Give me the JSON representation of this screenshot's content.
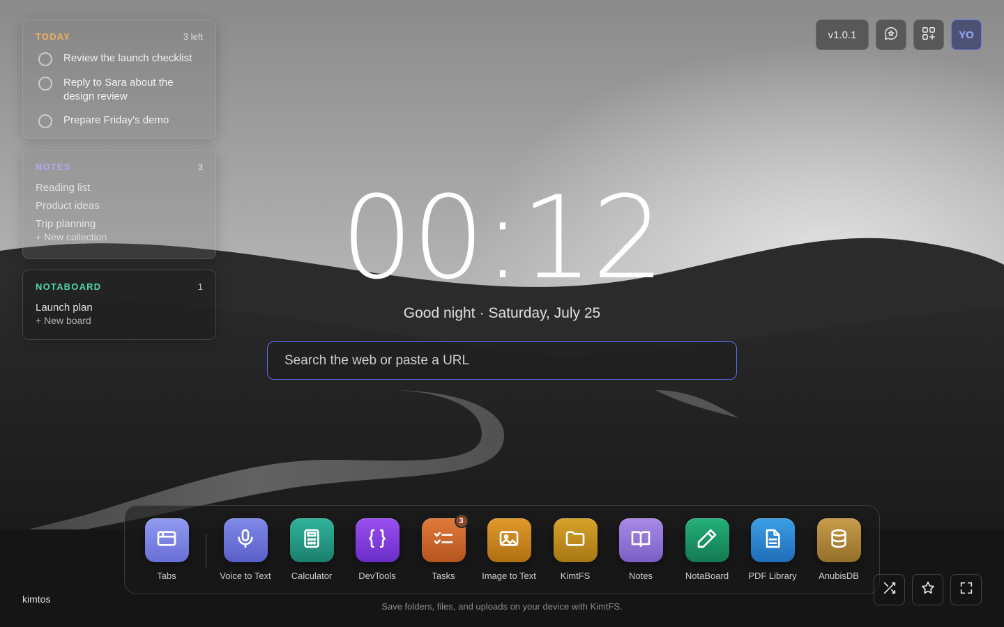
{
  "today": {
    "title": "TODAY",
    "count": "3 left",
    "items": [
      {
        "text": "Review the launch checklist"
      },
      {
        "text": "Reply to Sara about the design review"
      },
      {
        "text": "Prepare Friday's demo"
      }
    ]
  },
  "notes": {
    "title": "NOTES",
    "count": "3",
    "items": [
      "Reading list",
      "Product ideas",
      "Trip planning"
    ],
    "new_label": "+ New collection"
  },
  "notaboard": {
    "title": "NOTABOARD",
    "count": "1",
    "items": [
      "Launch plan"
    ],
    "new_label": "+ New board"
  },
  "topbar": {
    "version": "v1.0.1",
    "avatar_initials": "YO",
    "icons": [
      "chat-sparkle-icon",
      "apps-grid-icon"
    ]
  },
  "clock": {
    "time": "00:12",
    "greeting": "Good night",
    "separator": "·",
    "date": "Saturday, July 25"
  },
  "search": {
    "placeholder": "Search the web or paste a URL"
  },
  "dock": {
    "apps": [
      {
        "label": "Tabs",
        "icon": "browser-window-icon",
        "color_from": "#8f9af0",
        "color_to": "#6a6fd6"
      },
      {
        "label": "Voice to Text",
        "icon": "microphone-icon",
        "color_from": "#7f8ae8",
        "color_to": "#5a5fc8"
      },
      {
        "label": "Calculator",
        "icon": "calculator-icon",
        "color_from": "#2fb39a",
        "color_to": "#1b7f6e"
      },
      {
        "label": "DevTools",
        "icon": "curly-braces-icon",
        "color_from": "#9a4ff0",
        "color_to": "#6a2dc8"
      },
      {
        "label": "Tasks",
        "icon": "checklist-icon",
        "color_from": "#e07a3a",
        "color_to": "#b5541f",
        "badge": "3"
      },
      {
        "label": "Image to Text",
        "icon": "image-icon",
        "color_from": "#e09a2a",
        "color_to": "#b06f12"
      },
      {
        "label": "KimtFS",
        "icon": "folder-icon",
        "color_from": "#d6a22a",
        "color_to": "#a67814"
      },
      {
        "label": "Notes",
        "icon": "open-book-icon",
        "color_from": "#a88ae6",
        "color_to": "#7a5fc4"
      },
      {
        "label": "NotaBoard",
        "icon": "pencil-icon",
        "color_from": "#24b07a",
        "color_to": "#137a52"
      },
      {
        "label": "PDF Library",
        "icon": "document-icon",
        "color_from": "#3b9ee6",
        "color_to": "#1f6db8"
      },
      {
        "label": "AnubisDB",
        "icon": "database-icon",
        "color_from": "#c89b4a",
        "color_to": "#94702a"
      }
    ]
  },
  "footer": {
    "brand": "kimtos",
    "hint": "Save folders, files, and uploads on your device with KimtFS.",
    "buttons": [
      "shuffle-icon",
      "star-icon",
      "fullscreen-icon"
    ]
  },
  "colors": {
    "accent": "#5a6cf0",
    "today_title": "#f0b060",
    "notes_title": "#b8a6f3",
    "notaboard_title": "#4fd6a8"
  }
}
